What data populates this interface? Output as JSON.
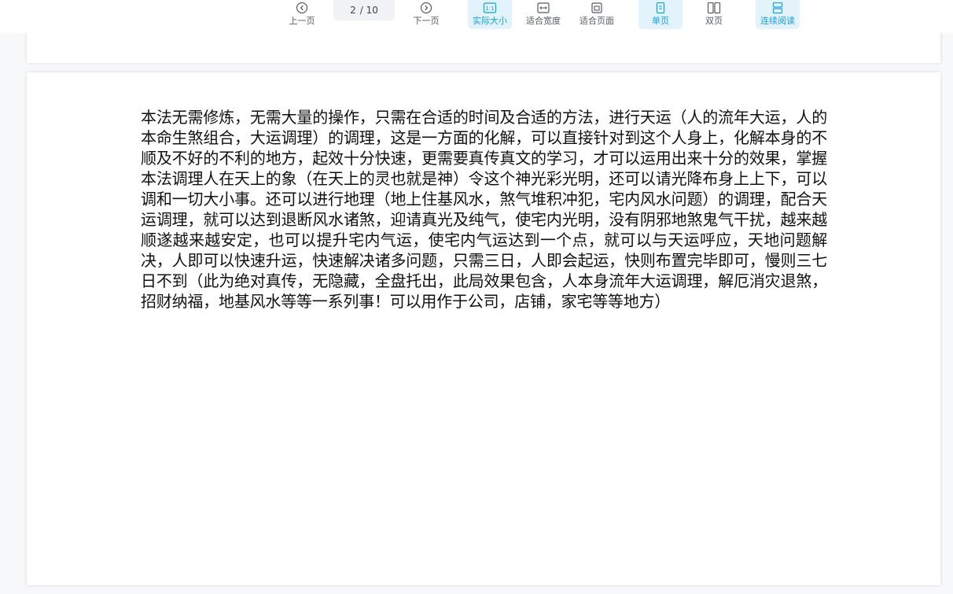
{
  "toolbar": {
    "prev_label": "上一页",
    "next_label": "下一页",
    "page_current": "2",
    "page_total": "/ 10",
    "actual_size_label": "实际大小",
    "actual_size_glyph": "1:1",
    "fit_width_label": "适合宽度",
    "fit_page_label": "适合页面",
    "single_page_label": "单页",
    "double_page_label": "双页",
    "continuous_label": "连续阅读"
  },
  "document": {
    "body_text": "本法无需修炼，无需大量的操作，只需在合适的时间及合适的方法，进行天运（人的流年大运，人的本命生煞组合，大运调理）的调理，这是一方面的化解，可以直接针对到这个人身上，化解本身的不顺及不好的不利的地方，起效十分快速，更需要真传真文的学习，才可以运用出来十分的效果，掌握本法调理人在天上的象（在天上的灵也就是神）令这个神光彩光明，还可以请光降布身上上下，可以调和一切大小事。还可以进行地理（地上住基风水，煞气堆积冲犯，宅内风水问题）的调理，配合天运调理，就可以达到退断风水诸煞，迎请真光及纯气，使宅内光明，没有阴邪地煞鬼气干扰，越来越顺遂越来越安定，也可以提升宅内气运，使宅内气运达到一个点，就可以与天运呼应，天地问题解决，人即可以快速升运，快速解决诸多问题，只需三日，人即会起运，快则布置完毕即可，慢则三七日不到（此为绝对真传，无隐藏，全盘托出，此局效果包含，人本身流年大运调理，解厄消灾退煞，招财纳福，地基风水等等一系列事！可以用作于公司，店铺，家宅等等地方）"
  },
  "colors": {
    "accent": "#13a0df",
    "accent_bg": "#e3f3fc",
    "toolbar_text": "#555a63",
    "background": "#f7f8fa"
  },
  "icons": {
    "prev": "chevron-left-circle-icon",
    "next": "chevron-right-circle-icon",
    "actual_size": "one-to-one-icon",
    "fit_width": "fit-width-icon",
    "fit_page": "fit-page-icon",
    "single_page": "single-page-icon",
    "double_page": "double-page-icon",
    "continuous": "continuous-scroll-icon"
  }
}
